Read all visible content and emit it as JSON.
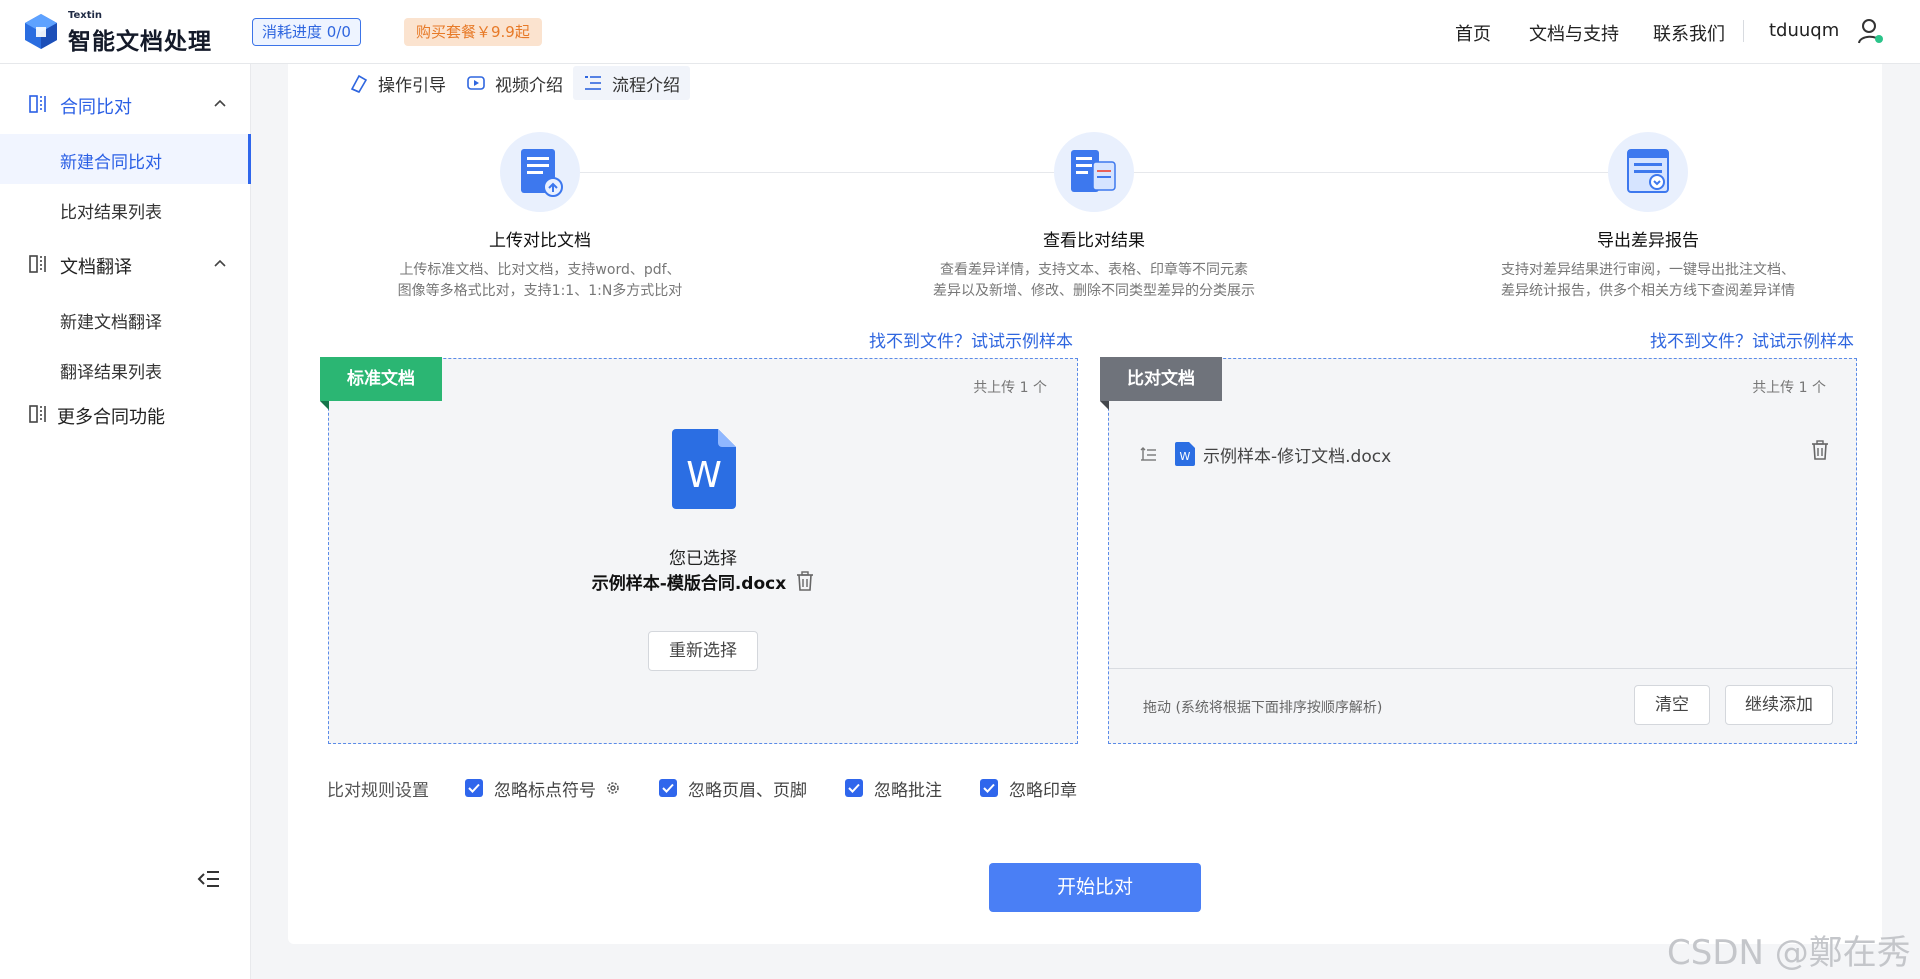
{
  "header": {
    "brand_small": "Textin",
    "brand": "智能文档处理",
    "usage": "消耗进度  0/0",
    "buy": "购买套餐￥9.9起",
    "nav": [
      "首页",
      "文档与支持",
      "联系我们"
    ],
    "username": "tduuqm"
  },
  "sidebar": {
    "groups": [
      {
        "label": "合同比对",
        "items": [
          "新建合同比对",
          "比对结果列表"
        ]
      },
      {
        "label": "文档翻译",
        "items": [
          "新建文档翻译",
          "翻译结果列表"
        ]
      },
      {
        "label": "更多合同功能"
      }
    ],
    "active_item": "新建合同比对"
  },
  "guide_links": [
    "操作引导",
    "视频介绍",
    "流程介绍"
  ],
  "steps": [
    {
      "title": "上传对比文档",
      "desc1": "上传标准文档、比对文档，支持word、pdf、",
      "desc2": "图像等多格式比对，支持1:1、1:N多方式比对"
    },
    {
      "title": "查看比对结果",
      "desc1": "查看差异详情，支持文本、表格、印章等不同元素",
      "desc2": "差异以及新增、修改、删除不同类型差异的分类展示"
    },
    {
      "title": "导出差异报告",
      "desc1": "支持对差异结果进行审阅，一键导出批注文档、",
      "desc2": "差异统计报告，供多个相关方线下查阅差异详情"
    }
  ],
  "sample_link": "找不到文件？试试示例样本",
  "standard_box": {
    "tag": "标准文档",
    "count": "共上传 1 个",
    "selected_label": "您已选择",
    "file_name": "示例样本-模版合同.docx",
    "reselect": "重新选择"
  },
  "compare_box": {
    "tag": "比对文档",
    "count": "共上传 1 个",
    "file_name": "示例样本-修订文档.docx",
    "drag_hint": "拖动 (系统将根据下面排序按顺序解析)",
    "clear": "清空",
    "add_more": "继续添加"
  },
  "rules": {
    "label": "比对规则设置",
    "options": [
      "忽略标点符号",
      "忽略页眉、页脚",
      "忽略批注",
      "忽略印章"
    ]
  },
  "start_button": "开始比对",
  "watermark": "CSDN @鄭在秀",
  "colors": {
    "primary": "#2f66ec",
    "green_tag": "#2bb673",
    "gray_tag": "#6f737b",
    "buy_orange": "#e77a28"
  }
}
